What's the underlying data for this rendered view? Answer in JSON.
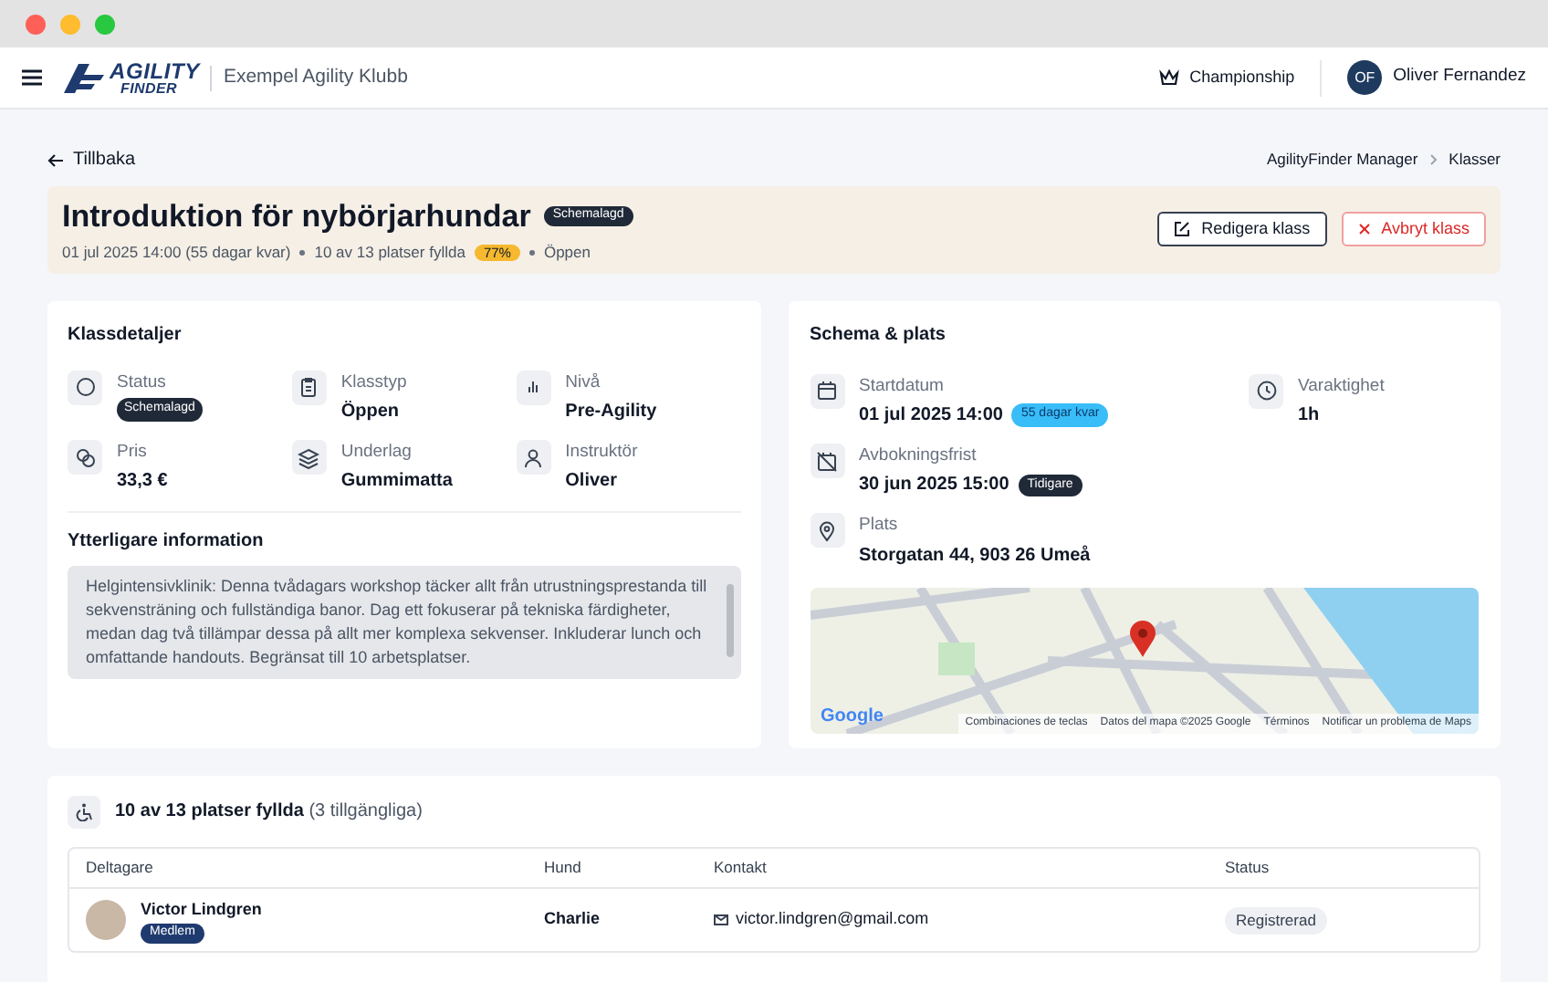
{
  "header": {
    "logo_top": "AGILITY",
    "logo_bottom": "FINDER",
    "club": "Exempel Agility Klubb",
    "championship": "Championship",
    "user": {
      "initials": "OF",
      "name": "Oliver Fernandez"
    }
  },
  "nav": {
    "back": "Tillbaka",
    "breadcrumbs": [
      "AgilityFinder Manager",
      "Klasser"
    ]
  },
  "class_header": {
    "title": "Introduktion för nybörjarhundar",
    "status_badge": "Schemalagd",
    "date": "01 jul 2025 14:00 (55 dagar kvar)",
    "filled": "10 av 13 platser fyllda",
    "percent": "77%",
    "type": "Öppen",
    "buttons": [
      {
        "label": "Redigera klass",
        "kind": "edit"
      },
      {
        "label": "Avbryt klass",
        "kind": "cancel"
      }
    ]
  },
  "details": {
    "title": "Klassdetaljer",
    "items": [
      {
        "label": "Status",
        "value": "Schemalagd",
        "kind": "badge"
      },
      {
        "label": "Klasstyp",
        "value": "Öppen",
        "kind": "text"
      },
      {
        "label": "Nivå",
        "value": "Pre-Agility",
        "kind": "text"
      },
      {
        "label": "Pris",
        "value": "33,3 €",
        "kind": "text"
      },
      {
        "label": "Underlag",
        "value": "Gummimatta",
        "kind": "text"
      },
      {
        "label": "Instruktör",
        "value": "Oliver",
        "kind": "text"
      }
    ]
  },
  "additional": {
    "title": "Ytterligare information",
    "text": "Helgintensivklinik: Denna tvådagars workshop täcker allt från utrustningsprestanda till sekvensträning och fullständiga banor. Dag ett fokuserar på tekniska färdigheter, medan dag två tillämpar dessa på allt mer komplexa sekvenser. Inkluderar lunch och omfattande handouts. Begränsat till 10 arbetsplatser."
  },
  "schedule": {
    "title": "Schema & plats",
    "items": [
      {
        "label": "Startdatum",
        "value": "01 jul 2025 14:00",
        "badge": {
          "text": "55 dagar kvar",
          "color": "#38bdf8"
        }
      },
      {
        "label": "Varaktighet",
        "value": "1h"
      },
      {
        "label": "Avbokningsfrist",
        "value": "30 jun 2025 15:00",
        "badge": {
          "text": "Tidigare",
          "color": "#1f2937"
        }
      },
      {
        "label": "Plats",
        "value": "Storgatan 44, 903 26 Umeå"
      }
    ],
    "map": {
      "logo": "Google",
      "attribution": [
        "Combinaciones de teclas",
        "Datos del mapa ©2025 Google",
        "Términos",
        "Notificar un problema de Maps"
      ]
    }
  },
  "participants": {
    "summary": "10 av 13 platser fyllda",
    "available": "(3 tillgängliga)",
    "columns": [
      "Deltagare",
      "Hund",
      "Kontakt",
      "Status"
    ],
    "rows": [
      {
        "name": "Victor Lindgren",
        "badge": "Medlem",
        "dog": "Charlie",
        "email": "victor.lindgren@gmail.com",
        "status": "Registrerad"
      }
    ]
  }
}
